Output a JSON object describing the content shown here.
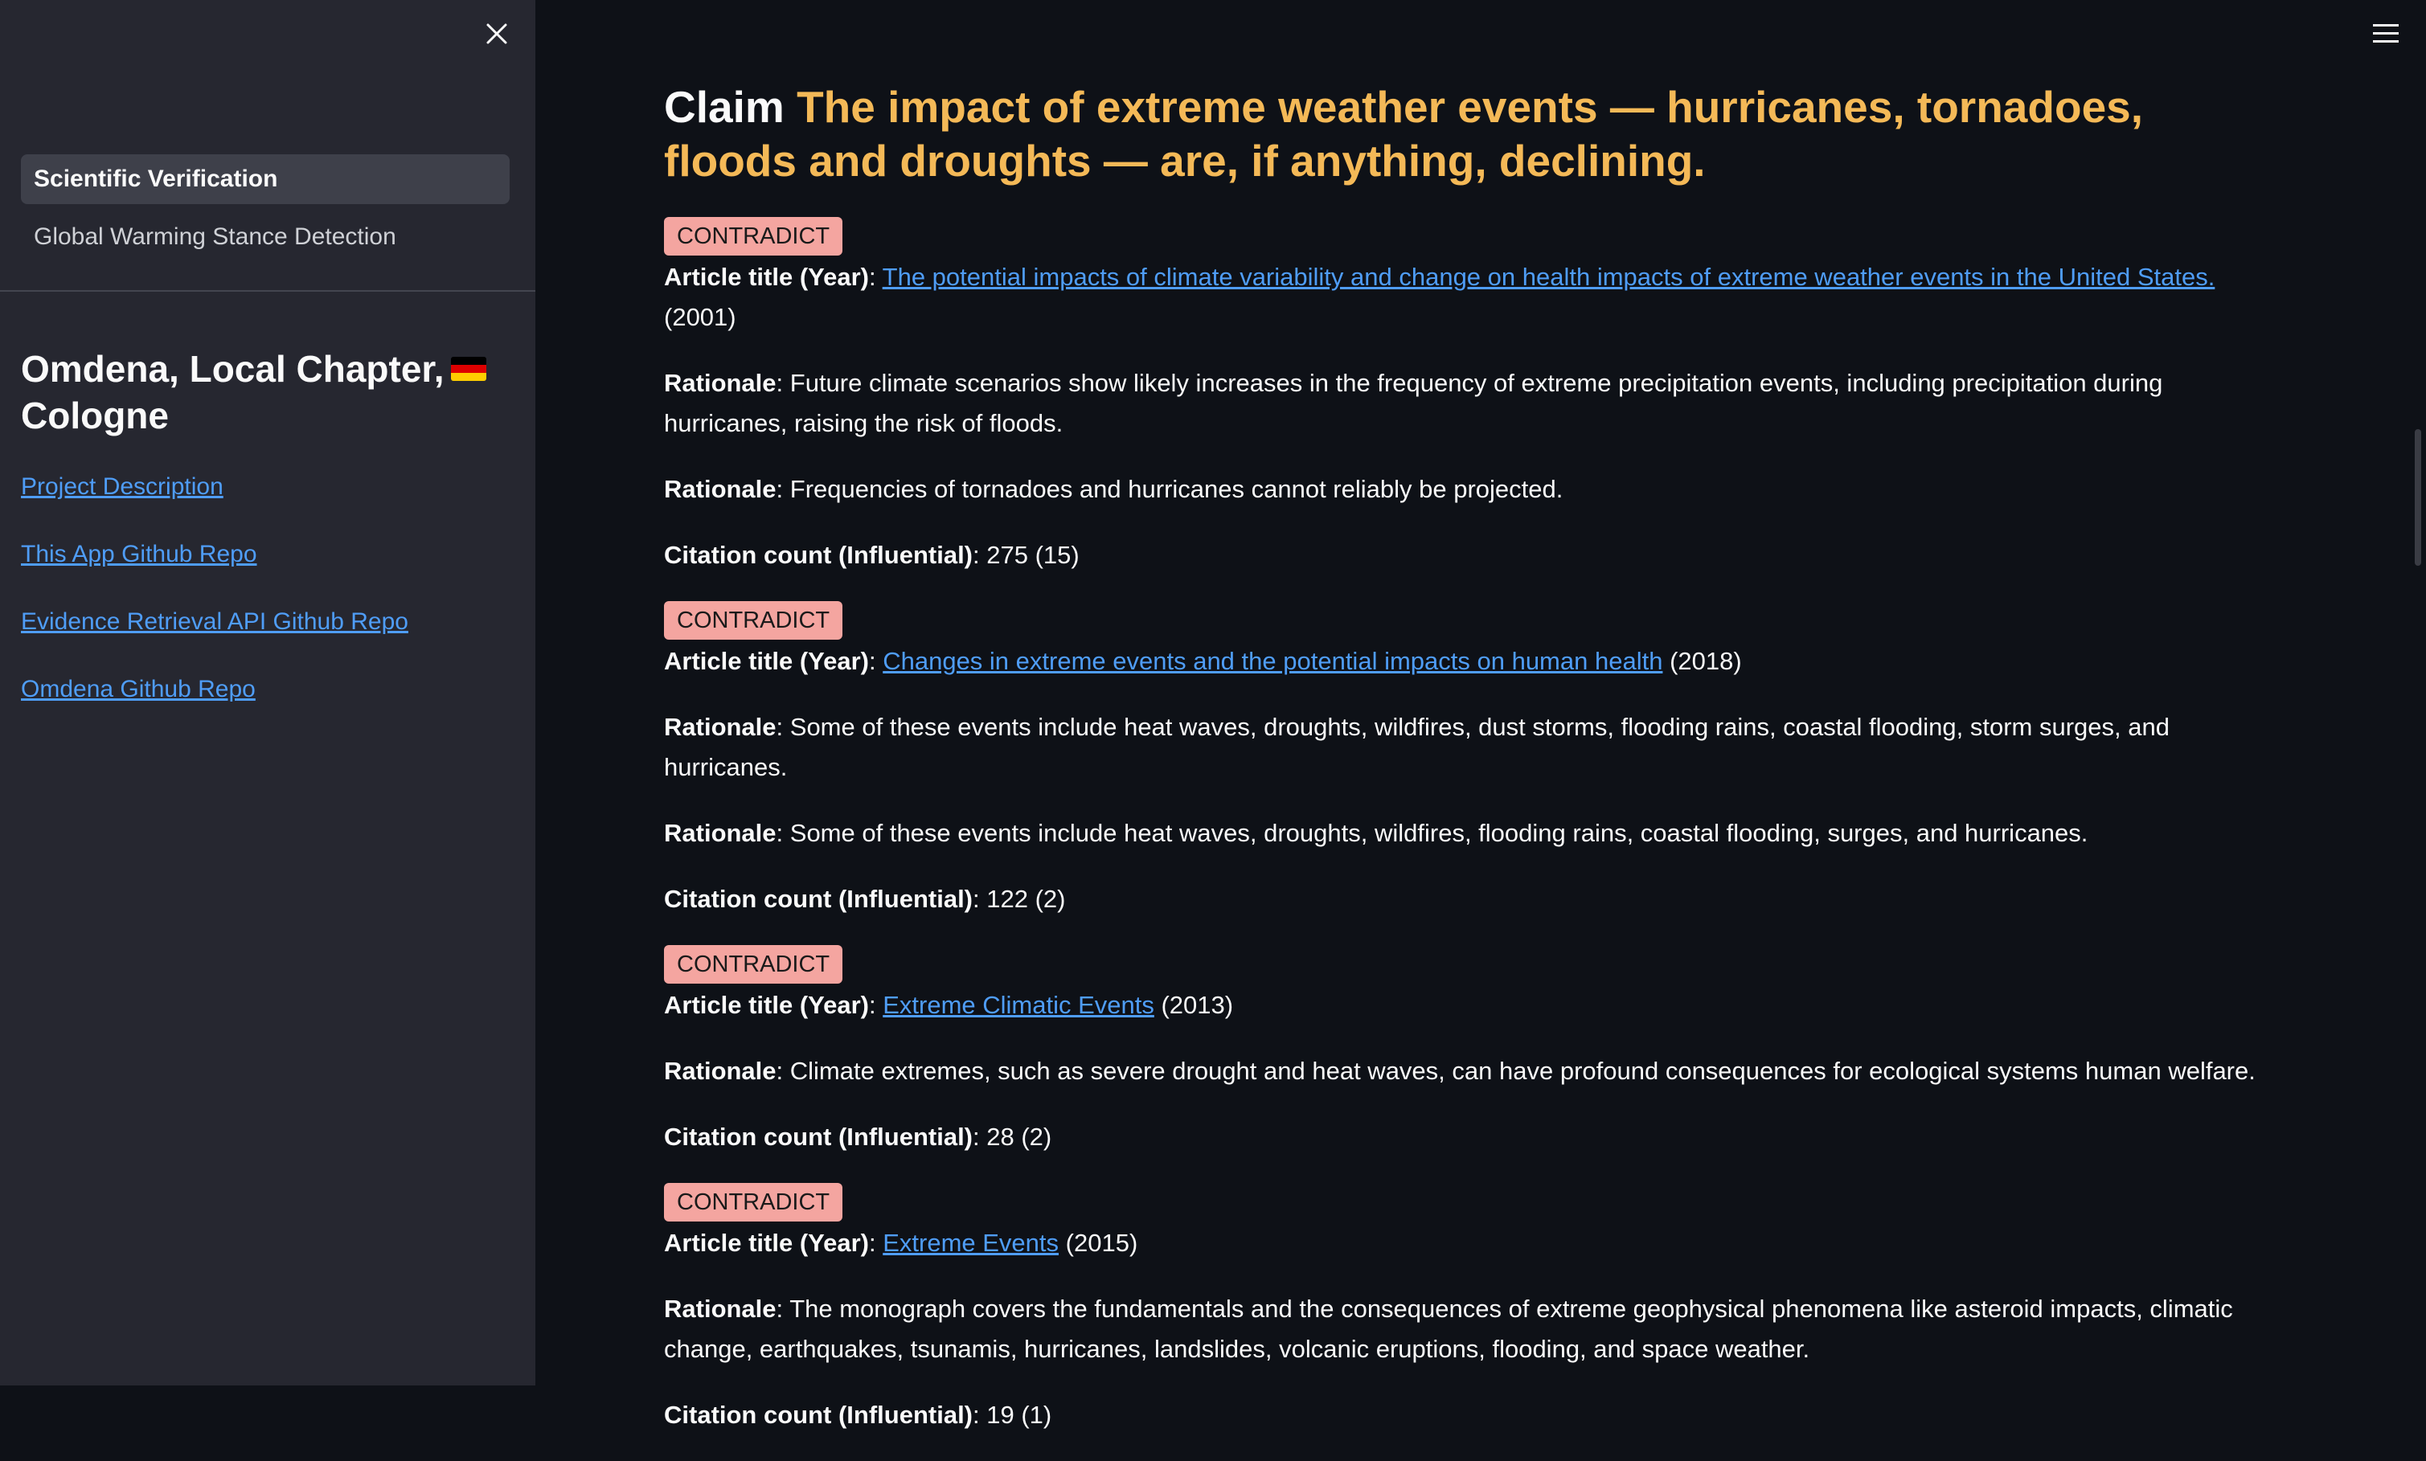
{
  "sidebar": {
    "nav": [
      {
        "label": "Scientific Verification",
        "active": true
      },
      {
        "label": "Global Warming Stance Detection",
        "active": false
      }
    ],
    "org_title": "Omdena, Local Chapter,",
    "org_title_2": "Cologne",
    "links": [
      {
        "label": "Project Description"
      },
      {
        "label": "This App Github Repo"
      },
      {
        "label": "Evidence Retrieval API Github Repo"
      },
      {
        "label": "Omdena Github Repo"
      }
    ]
  },
  "claim": {
    "label": "Claim",
    "text": "The impact of extreme weather events — hurricanes, tornadoes, floods and droughts — are, if anything, declining."
  },
  "labels": {
    "article_title": "Article title (Year)",
    "rationale": "Rationale",
    "citation": "Citation count (Influential)"
  },
  "evidences": [
    {
      "verdict": "CONTRADICT",
      "title": "The potential impacts of climate variability and change on health impacts of extreme weather events in the United States.",
      "year": "(2001)",
      "rationales": [
        "Future climate scenarios show likely increases in the frequency of extreme precipitation events, including precipitation during hurricanes, raising the risk of floods.",
        "Frequencies of tornadoes and hurricanes cannot reliably be projected."
      ],
      "citations": "275 (15)"
    },
    {
      "verdict": "CONTRADICT",
      "title": "Changes in extreme events and the potential impacts on human health",
      "year": "(2018)",
      "rationales": [
        "Some of these events include heat waves, droughts, wildfires, dust storms, flooding rains, coastal flooding, storm surges, and hurricanes.",
        "Some of these events include heat waves, droughts, wildfires, flooding rains, coastal flooding, surges, and hurricanes."
      ],
      "citations": "122 (2)"
    },
    {
      "verdict": "CONTRADICT",
      "title": "Extreme Climatic Events",
      "year": "(2013)",
      "rationales": [
        "Climate extremes, such as severe drought and heat waves, can have profound consequences for ecological systems human welfare."
      ],
      "citations": "28 (2)"
    },
    {
      "verdict": "CONTRADICT",
      "title": "Extreme Events",
      "year": "(2015)",
      "rationales": [
        "The monograph covers the fundamentals and the consequences of extreme geophysical phenomena like asteroid impacts, climatic change, earthquakes, tsunamis, hurricanes, landslides, volcanic eruptions, flooding, and space weather."
      ],
      "citations": "19 (1)"
    }
  ],
  "colors": {
    "background": "#0e1117",
    "sidebar": "#262730",
    "claim_accent": "#f4b957",
    "link": "#4f9df7",
    "badge": "#f4a5a0"
  },
  "icons": {
    "close": "close-icon",
    "menu": "hamburger-menu-icon",
    "flag": "germany-flag-icon"
  }
}
